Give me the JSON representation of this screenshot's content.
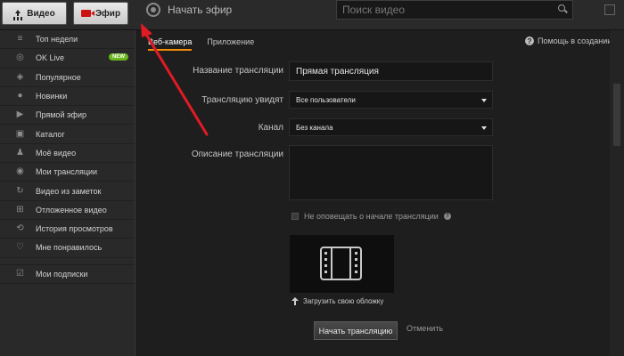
{
  "topbar": {
    "video_button": "Видео",
    "live_button": "Эфир",
    "page_title": "Начать эфир",
    "search_placeholder": "Поиск видео"
  },
  "sidebar": {
    "items": [
      {
        "label": "Топ недели",
        "icon": "list-icon"
      },
      {
        "label": "OK Live",
        "icon": "ok-live-icon",
        "badge": "NEW"
      },
      {
        "label": "Популярное",
        "icon": "trending-icon"
      },
      {
        "label": "Новинки",
        "icon": "new-icon"
      },
      {
        "label": "Прямой эфир",
        "icon": "camera-icon"
      },
      {
        "label": "Каталог",
        "icon": "catalog-icon"
      },
      {
        "label": "Моё видео",
        "icon": "user-icon"
      },
      {
        "label": "Мои трансляции",
        "icon": "broadcast-icon"
      },
      {
        "label": "Видео из заметок",
        "icon": "notes-icon"
      },
      {
        "label": "Отложенное видео",
        "icon": "deferred-icon"
      },
      {
        "label": "История просмотров",
        "icon": "history-icon"
      },
      {
        "label": "Мне понравилось",
        "icon": "like-icon"
      },
      {
        "label": "Мои подписки",
        "icon": "subscriptions-icon"
      }
    ]
  },
  "tabs": [
    {
      "label": "Веб-камера",
      "active": true
    },
    {
      "label": "Приложение",
      "active": false
    }
  ],
  "help_label": "Помощь в создании",
  "form": {
    "name_label": "Название трансляции",
    "name_value": "Прямая трансляция",
    "audience_label": "Трансляцию увидят",
    "audience_value": "Все пользователи",
    "channel_label": "Канал",
    "channel_value": "Без канала",
    "description_label": "Описание трансляции",
    "description_value": "",
    "notify_label": "Не оповещать о начале трансляции",
    "notify_checked": false,
    "upload_cover_label": "Загрузить свою обложку",
    "start_button": "Начать трансляцию",
    "cancel_link": "Отменить"
  },
  "colors": {
    "active_tab_underline": "#f48c06",
    "new_badge": "#6ab61e",
    "live_icon": "#cc1111",
    "annotation_arrow": "#e01b24"
  }
}
